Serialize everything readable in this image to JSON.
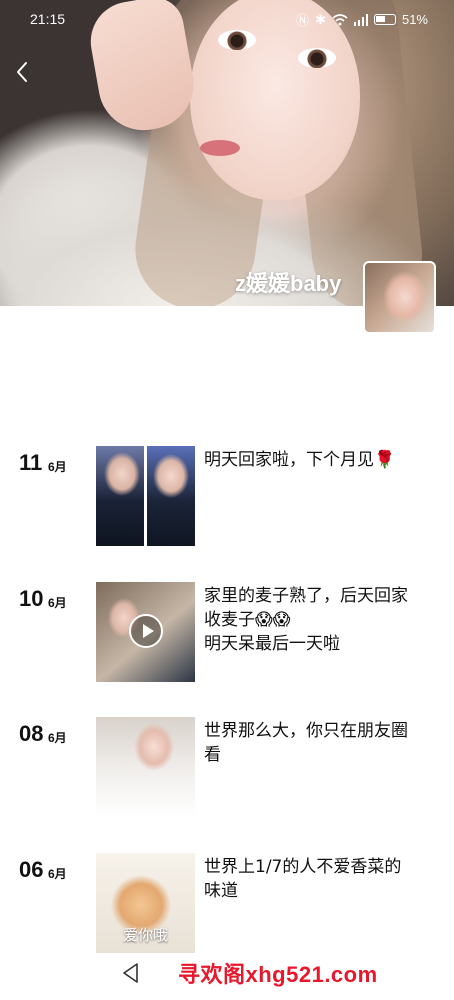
{
  "status_bar": {
    "time": "21:15",
    "battery": "51%"
  },
  "profile": {
    "username": "z媛媛baby"
  },
  "posts": [
    {
      "day": "11",
      "month": "6月",
      "text": "明天回家啦，下个月见🌹",
      "has_video": false,
      "thumb_caption": ""
    },
    {
      "day": "10",
      "month": "6月",
      "text": "家里的麦子熟了，后天回家\n收麦子😱😱\n明天呆最后一天啦",
      "has_video": true,
      "thumb_caption": ""
    },
    {
      "day": "08",
      "month": "6月",
      "text": "世界那么大，你只在朋友圈\n看",
      "has_video": false,
      "thumb_caption": ""
    },
    {
      "day": "06",
      "month": "6月",
      "text": "世界上1/7的人不爱香菜的\n味道",
      "has_video": false,
      "thumb_caption": "爱你哦"
    }
  ],
  "watermark": "寻欢阁xhg521.com"
}
